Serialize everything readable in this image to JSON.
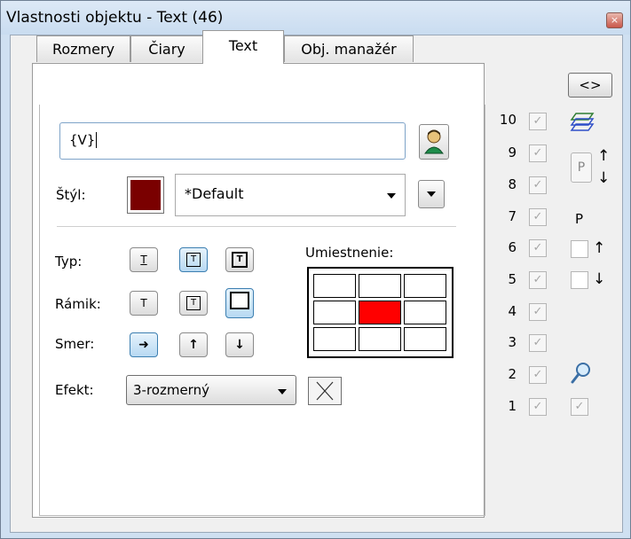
{
  "window": {
    "title": "Vlastnosti objektu - Text (46)",
    "close_glyph": "×"
  },
  "tabs": [
    {
      "label": "Rozmery"
    },
    {
      "label": "Čiary"
    },
    {
      "label": "Text",
      "active": true
    },
    {
      "label": "Obj. manažér"
    }
  ],
  "text_section": {
    "value": "{V}"
  },
  "style": {
    "label": "Štýl:",
    "color": "#7a0000",
    "value": "*Default"
  },
  "type_row": {
    "label": "Typ:"
  },
  "frame_row": {
    "label": "Rámik:"
  },
  "direction_row": {
    "label": "Smer:",
    "right": "➜",
    "up": "↑",
    "down": "↓"
  },
  "effect": {
    "label": "Efekt:",
    "value": "3-rozmerný"
  },
  "placement": {
    "label": "Umiestnenie:",
    "selected_row": 1,
    "selected_col": 1,
    "selected_color": "#ff0000"
  },
  "layers": {
    "numbers": [
      "10",
      "9",
      "8",
      "7",
      "6",
      "5",
      "4",
      "3",
      "2",
      "1"
    ],
    "check_glyph": "✓"
  },
  "side": {
    "nav_label": "<>",
    "p_label": "P",
    "arrow_up": "↑",
    "arrow_down": "↓"
  }
}
